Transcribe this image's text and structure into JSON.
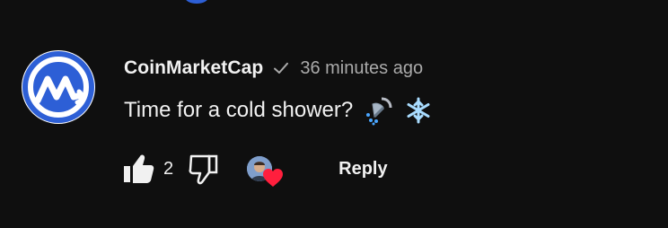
{
  "comment": {
    "author": "CoinMarketCap",
    "time": "36 minutes ago",
    "text": "Time for a cold shower?",
    "emoji": [
      "shower-icon",
      "snowflake-icon"
    ],
    "likes": "2",
    "reply_label": "Reply",
    "heart_color": "#ff1f3d",
    "avatar_brand_color": "#2d5fd6"
  },
  "icons": [
    "verified-check-icon",
    "thumbs-up-icon",
    "thumbs-down-icon",
    "creator-heart-icon"
  ]
}
